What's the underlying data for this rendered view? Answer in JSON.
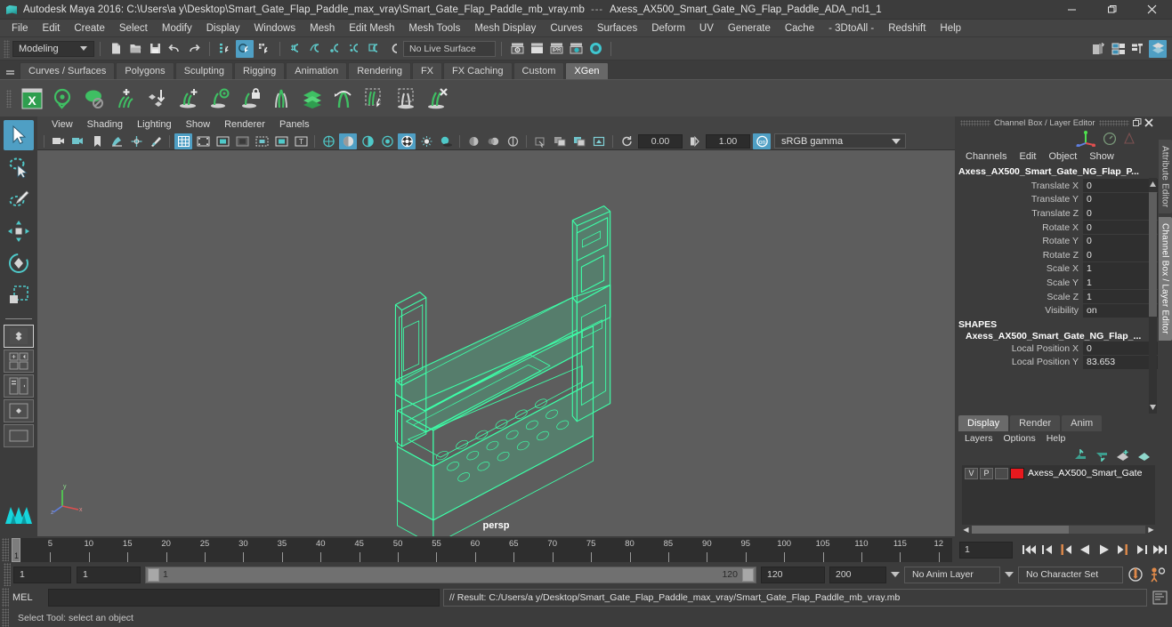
{
  "titlebar": {
    "app_title": "Autodesk Maya 2016: C:\\Users\\a y\\Desktop\\Smart_Gate_Flap_Paddle_max_vray\\Smart_Gate_Flap_Paddle_mb_vray.mb",
    "separator": "---",
    "selected_object": "Axess_AX500_Smart_Gate_NG_Flap_Paddle_ADA_ncl1_1",
    "minimize": "–",
    "maximize": "❐",
    "close": "✕"
  },
  "menubar": {
    "items": [
      "File",
      "Edit",
      "Create",
      "Select",
      "Modify",
      "Display",
      "Windows",
      "Mesh",
      "Edit Mesh",
      "Mesh Tools",
      "Mesh Display",
      "Curves",
      "Surfaces",
      "Deform",
      "UV",
      "Generate",
      "Cache",
      "- 3DtoAll -",
      "Redshift",
      "Help"
    ]
  },
  "statusline": {
    "menu_set": "Modeling",
    "live_surface": "No Live Surface",
    "icons": [
      "new-scene-icon",
      "open-scene-icon",
      "save-scene-icon",
      "undo-icon",
      "redo-icon",
      "select-by-hierarchy-icon",
      "select-by-object-icon",
      "select-by-component-icon",
      "snap-to-grid-icon",
      "snap-to-curve-icon",
      "snap-to-point-icon",
      "snap-to-projected-center-icon",
      "snap-to-view-plane-icon",
      "make-live-icon",
      "show-render-view-icon",
      "render-current-frame-icon",
      "ipr-render-icon",
      "render-settings-icon",
      "hypershade-icon",
      "toggle-sidebar-icon",
      "attribute-editor-toggle-icon",
      "tool-settings-toggle-icon",
      "channel-box-toggle-icon"
    ]
  },
  "shelf": {
    "tabs": [
      "Curves / Surfaces",
      "Polygons",
      "Sculpting",
      "Rigging",
      "Animation",
      "Rendering",
      "FX",
      "FX Caching",
      "Custom",
      "XGen"
    ],
    "active_tab": "XGen",
    "icons": [
      "xgen-window-icon",
      "xgen-preview-icon",
      "xgen-disable-preview-icon",
      "add-collection-icon",
      "import-description-icon",
      "add-guide-icon",
      "guide-visibility-icon",
      "lock-guide-icon",
      "mirror-guides-icon",
      "groom-layers-icon",
      "guide-length-icon",
      "select-primitives-icon",
      "region-select-icon",
      "delete-guides-icon"
    ]
  },
  "toolbox": {
    "tools": [
      {
        "name": "select-tool",
        "selected": true
      },
      {
        "name": "lasso-select-tool",
        "selected": false
      },
      {
        "name": "paint-select-tool",
        "selected": false
      },
      {
        "name": "move-tool",
        "selected": false
      },
      {
        "name": "rotate-tool",
        "selected": false
      },
      {
        "name": "scale-tool",
        "selected": false
      }
    ],
    "layouts": [
      "single-perspective-layout",
      "four-view-layout",
      "persp-outliner-layout",
      "persp-graph-layout",
      "hypershade-layout"
    ]
  },
  "viewport": {
    "menus": [
      "View",
      "Shading",
      "Lighting",
      "Show",
      "Renderer",
      "Panels"
    ],
    "camera_label": "persp",
    "exposure": "0.00",
    "gamma": "1.00",
    "color_management": "sRGB gamma",
    "toolbar_icons": [
      "select-camera-icon",
      "camera-attributes-icon",
      "bookmark-icon",
      "image-plane-icon",
      "two-d-pan-zoom-icon",
      "grease-pencil-icon",
      "grid-toggle-icon",
      "film-gate-icon",
      "resolution-gate-icon",
      "gate-mask-icon",
      "film-origin-icon",
      "safe-action-icon",
      "title-safe-icon",
      "wireframe-icon",
      "smooth-shade-all-icon",
      "shade-x-ray-icon",
      "use-default-material-icon",
      "wireframe-on-shaded-icon",
      "use-all-lights-icon",
      "shadows-icon",
      "screen-space-ao-icon",
      "motion-blur-icon",
      "multisample-icon",
      "isolate-select-icon",
      "xray-joints-icon",
      "xray-active-components-icon",
      "exposure-icon",
      "gamma-icon",
      "color-management-icon"
    ],
    "object_color": "#3dffa8"
  },
  "channel_box": {
    "panel_title": "Channel Box / Layer Editor",
    "menus": [
      "Channels",
      "Edit",
      "Object",
      "Show"
    ],
    "object_name": "Axess_AX500_Smart_Gate_NG_Flap_P...",
    "attributes": [
      {
        "label": "Translate X",
        "value": "0"
      },
      {
        "label": "Translate Y",
        "value": "0"
      },
      {
        "label": "Translate Z",
        "value": "0"
      },
      {
        "label": "Rotate X",
        "value": "0"
      },
      {
        "label": "Rotate Y",
        "value": "0"
      },
      {
        "label": "Rotate Z",
        "value": "0"
      },
      {
        "label": "Scale X",
        "value": "1"
      },
      {
        "label": "Scale Y",
        "value": "1"
      },
      {
        "label": "Scale Z",
        "value": "1"
      },
      {
        "label": "Visibility",
        "value": "on"
      }
    ],
    "shapes_header": "SHAPES",
    "shape_name": "Axess_AX500_Smart_Gate_NG_Flap_...",
    "shape_attributes": [
      {
        "label": "Local Position X",
        "value": "0"
      },
      {
        "label": "Local Position Y",
        "value": "83.653"
      }
    ]
  },
  "layer_editor": {
    "tabs": [
      "Display",
      "Render",
      "Anim"
    ],
    "active_tab": "Display",
    "menus": [
      "Layers",
      "Options",
      "Help"
    ],
    "buttons": [
      "move-layer-up-icon",
      "move-layer-down-icon",
      "new-layer-icon",
      "new-layer-from-selected-icon"
    ],
    "layers": [
      {
        "visibility": "V",
        "playback": "P",
        "type": "",
        "color": "#e8191e",
        "name": "Axess_AX500_Smart_Gate"
      }
    ]
  },
  "right_tabs": [
    {
      "label": "Attribute Editor",
      "active": false
    },
    {
      "label": "Channel Box / Layer Editor",
      "active": true
    }
  ],
  "time_slider": {
    "tick_labels": [
      "5",
      "10",
      "15",
      "20",
      "25",
      "30",
      "35",
      "40",
      "45",
      "50",
      "55",
      "60",
      "65",
      "70",
      "75",
      "80",
      "85",
      "90",
      "95",
      "100",
      "105",
      "110",
      "115",
      "12"
    ],
    "current_frame_marker": "1",
    "current_frame_field": "1",
    "playback_buttons": [
      "go-to-start-icon",
      "step-back-keyframe-icon",
      "step-back-frame-icon",
      "play-backwards-icon",
      "play-forwards-icon",
      "step-forward-frame-icon",
      "step-forward-keyframe-icon",
      "go-to-end-icon"
    ]
  },
  "range_slider": {
    "anim_start": "1",
    "range_start": "1",
    "bar_left_label": "1",
    "bar_right_label": "120",
    "range_end": "120",
    "anim_end": "200",
    "anim_layer": "No Anim Layer",
    "character_set": "No Character Set",
    "auto_key_icon": "auto-keyframe-icon",
    "anim_prefs_icon": "animation-preferences-icon"
  },
  "command_line": {
    "label": "MEL",
    "input_value": "",
    "result_text": "// Result: C:/Users/a y/Desktop/Smart_Gate_Flap_Paddle_max_vray/Smart_Gate_Flap_Paddle_mb_vray.mb",
    "script_editor_icon": "script-editor-icon"
  },
  "help_line": {
    "text": "Select Tool: select an object"
  }
}
